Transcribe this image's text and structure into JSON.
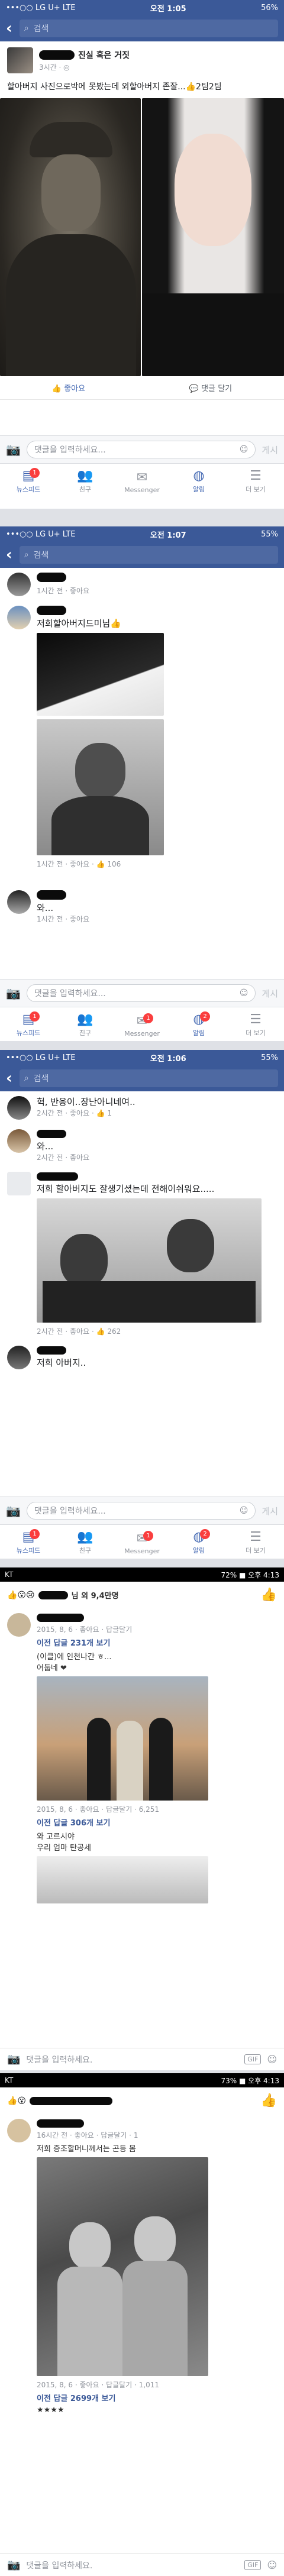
{
  "shot1": {
    "status": {
      "carrier": "•••○○ LG U+  LTE",
      "time": "오전 1:05",
      "battery": "56%"
    },
    "search_placeholder": "검색",
    "post": {
      "title": "진실 혹은 거짓",
      "time": "3시간 · ",
      "body": "할아버지 사진으로박에 못봤는데 외할아버지 존잘...👍2팀2팀"
    },
    "actions": {
      "like": "좋아요",
      "comment": "댓글 달기"
    },
    "comment_placeholder": "댓글을 입력하세요...",
    "post_label": "게시",
    "tabs": [
      {
        "label": "뉴스피드",
        "badge": "1",
        "icon": "newsfeed-icon"
      },
      {
        "label": "친구",
        "badge": "",
        "icon": "friends-icon"
      },
      {
        "label": "Messenger",
        "badge": "",
        "icon": "messenger-icon"
      },
      {
        "label": "알림",
        "badge": "",
        "icon": "notifications-icon"
      },
      {
        "label": "더 보기",
        "badge": "",
        "icon": "more-icon"
      }
    ]
  },
  "shot2": {
    "status": {
      "carrier": "•••○○ LG U+  LTE",
      "time": "오전 1:07",
      "battery": "55%"
    },
    "search_placeholder": "검색",
    "c1_meta": "1시간 전 · 좋아요",
    "c2_text": "저희할아버지드미님👍",
    "c2_meta": "1시간 전 · 좋아요 · 👍 106",
    "c3_text": "와...",
    "c3_meta": "1시간 전 · 좋아요",
    "comment_placeholder": "댓글을 입력하세요...",
    "post_label": "게시",
    "tabs": [
      {
        "label": "뉴스피드",
        "badge": "1"
      },
      {
        "label": "친구",
        "badge": ""
      },
      {
        "label": "Messenger",
        "badge": "1"
      },
      {
        "label": "알림",
        "badge": "2"
      },
      {
        "label": "더 보기",
        "badge": ""
      }
    ]
  },
  "shot3": {
    "status": {
      "carrier": "•••○○ LG U+  LTE",
      "time": "오전 1:06",
      "battery": "55%"
    },
    "search_placeholder": "검색",
    "c1_text": "헉, 반응이..장난아니네여..",
    "c1_meta": "2시간 전 · 좋아요 · 👍 1",
    "c2_text": "와...",
    "c2_meta": "2시간 전 · 좋아요",
    "c3_text": "저희 할아버지도 잘생기셨는데 전해이쉬워요.....",
    "c3_meta": "2시간 전 · 좋아요 · 👍 262",
    "c4_text": "저희 아버지..",
    "comment_placeholder": "댓글을 입력하세요...",
    "post_label": "게시",
    "tabs": [
      {
        "label": "뉴스피드",
        "badge": "1"
      },
      {
        "label": "친구",
        "badge": ""
      },
      {
        "label": "Messenger",
        "badge": "1"
      },
      {
        "label": "알림",
        "badge": "2"
      },
      {
        "label": "더 보기",
        "badge": ""
      }
    ]
  },
  "shot4": {
    "status": {
      "left": "KT",
      "right": "72% ■ 오후 4:13"
    },
    "header": "님 외 9,4만명",
    "meta1": "2015, 8, 6 · 좋아요 · 답글달기",
    "replies": "이전 답글 231개 보기",
    "r1": "(이클)에 인천나간 ㅎ...",
    "r2": "어둡네 ❤",
    "meta2": "2015, 8, 6 · 좋아요 · 답글달기 · 6,251",
    "replies2": "이전 답글 306개 보기",
    "r3": "와 고르시야",
    "r4": "우리 엄마 탄공세",
    "comment_placeholder": "댓글을 입력하세요.",
    "gif": "GIF"
  },
  "shot5": {
    "status": {
      "left": "KT",
      "right": "73% ■ 오후 4:13"
    },
    "meta1": "16시간 전 · 좋아요 · 답글달기 · 1",
    "text": "저희 증조할머니께서는 곤등 몸",
    "meta2": "2015, 8, 6 · 좋아요 · 답글달기 · 1,011",
    "replies": "이전 답글 2699개 보기",
    "r1": "★★★★",
    "comment_placeholder": "댓글을 입력하세요.",
    "gif": "GIF"
  }
}
